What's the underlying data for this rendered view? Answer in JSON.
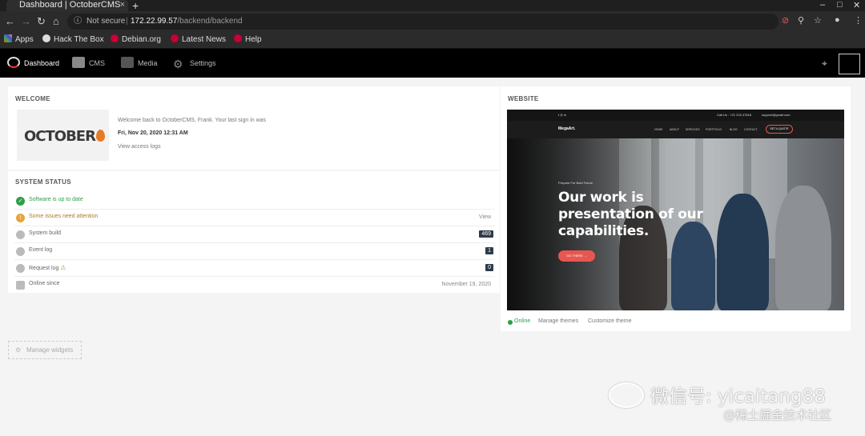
{
  "browser": {
    "tab_title": "Dashboard | OctoberCMS",
    "tab_close": "×",
    "new_tab": "+",
    "security": "Not secure",
    "url_host": "172.22.99.57",
    "url_path": "/backend/backend",
    "bookmarks": [
      "Apps",
      "Hack The Box",
      "Debian.org",
      "Latest News",
      "Help"
    ]
  },
  "nav": {
    "items": [
      "Dashboard",
      "CMS",
      "Media",
      "Settings"
    ]
  },
  "welcome": {
    "title": "Welcome",
    "logo_text": "OCTOBER",
    "message": "Welcome back to OctoberCMS, Frank. Your last sign in was",
    "last_signin": "Fri, Nov 20, 2020 12:31 AM",
    "access_logs_link": "View access logs"
  },
  "system_status": {
    "title": "System status",
    "up_to_date": "Software is up to date",
    "issues": "Some issues need attention",
    "issues_link": "View",
    "build_label": "System build",
    "build_value": "469",
    "event_log_label": "Event log",
    "event_log_value": "1",
    "request_log_label": "Request log",
    "request_log_value": "0",
    "online_since_label": "Online since",
    "online_since_value": "November 19, 2020"
  },
  "manage_widgets": "Manage widgets",
  "website": {
    "title": "Website",
    "preview": {
      "brand": "MegaArt.",
      "tagline": "Prepare For Bold Future",
      "headline": [
        "Our work is",
        "presentation of our",
        "capabilities."
      ],
      "cta": "GO THERE →",
      "nav_button": "GET A QUOTE",
      "menu": [
        "HOME",
        "ABOUT",
        "SERVICES",
        "PORTFOLIO",
        "BLOG",
        "CONTACT"
      ],
      "phone": "Call Us : +21 215 47818",
      "email": "support@gmail.com"
    },
    "status": "Online",
    "manage_themes": "Manage themes",
    "customize_theme": "Customize theme"
  },
  "watermark": {
    "line1": "微信号: yicaitang88",
    "line2": "@稀土掘金技术社区"
  },
  "colors": {
    "success": "#2e9e48",
    "warning": "#e8a43a",
    "badge": "#2f3b48",
    "accent": "#e8574f"
  }
}
